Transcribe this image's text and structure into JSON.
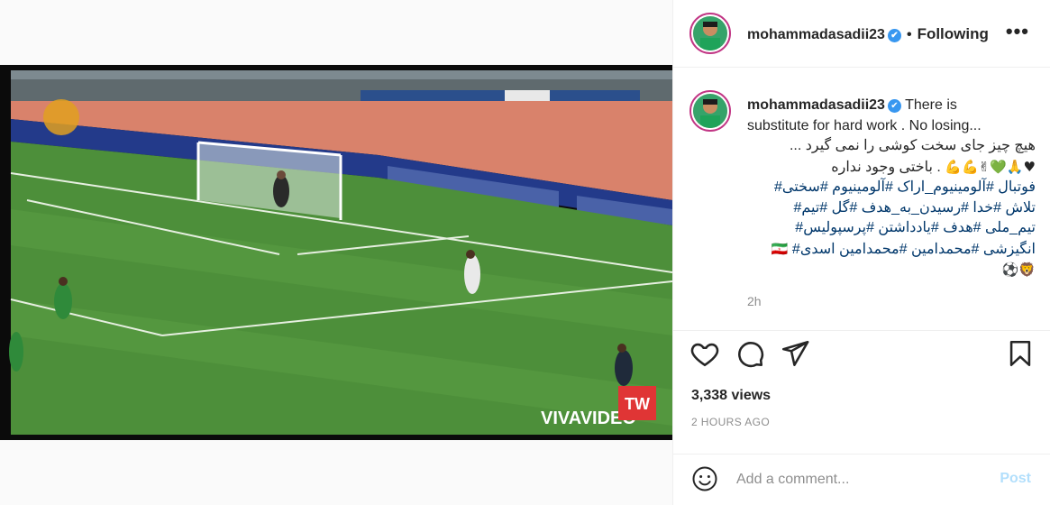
{
  "post": {
    "username": "mohammadasadii23",
    "verified_glyph": "✔",
    "separator": "•",
    "follow_state": "Following",
    "more_glyph": "•••"
  },
  "caption": {
    "username": "mohammadasadii23",
    "line1": "There is",
    "line2": "substitute for hard work . No losing...",
    "line3": "هیچ چیز جای سخت کوشی را نمی گیرد ...",
    "line4_emoji": "♥🙏💚✌💪💪",
    "line4_text": ". باختی وجود نداره",
    "tags1": "فوتبال #آلومینیوم_اراک #آلومینیوم #سختی#",
    "tags2": "تلاش #خدا #رسیدن_به_هدف #گل #تیم#",
    "tags3": "تیم_ملی #هدف #یادداشتن #پرسپولیس#",
    "tags4": "انگیزشی #محمدامین #محمدامین اسدی#",
    "tags4_flag": "🇮🇷",
    "line6_emoji": "🦁⚽",
    "time_ago": "2h"
  },
  "icons": [
    "heart-icon",
    "comment-icon",
    "share-icon",
    "bookmark-icon",
    "emoji-icon"
  ],
  "stats": {
    "views": "3,338 views",
    "timestamp": "2 HOURS AGO"
  },
  "comment": {
    "placeholder": "Add a comment...",
    "post_label": "Post"
  },
  "video": {
    "watermark": "VIVAVIDEO",
    "tw_badge": "TW"
  },
  "colors": {
    "accent_blue": "#3897f0",
    "post_disabled": "#b2dffc",
    "link_blue": "#00376b",
    "grey_text": "#8e8e8e"
  }
}
